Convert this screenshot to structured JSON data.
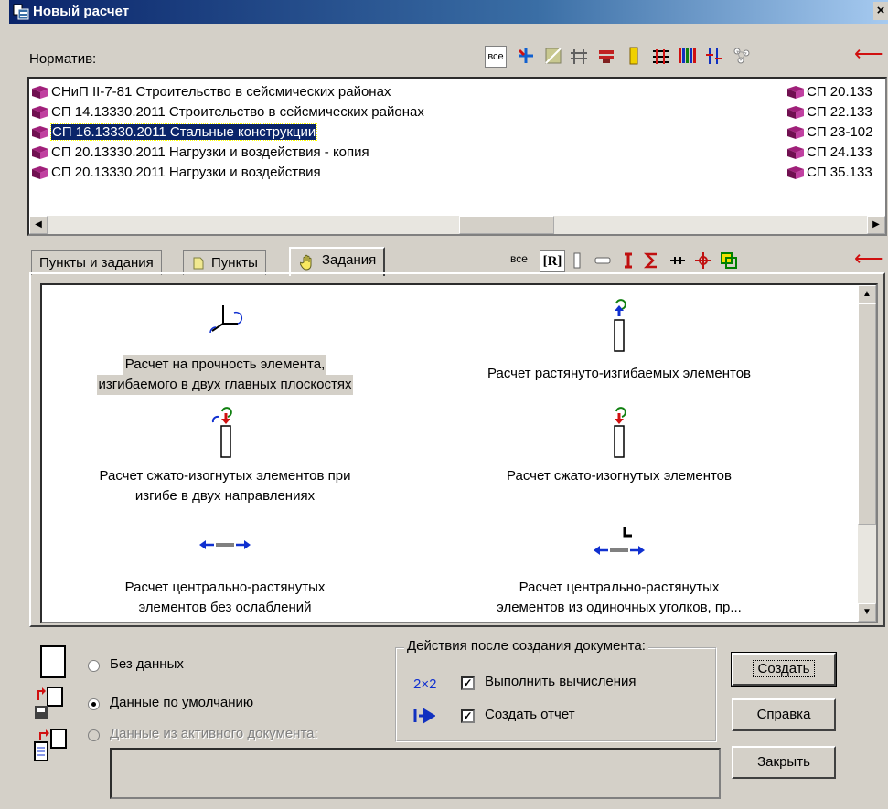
{
  "window": {
    "title": "Новый расчет",
    "close_glyph": "×"
  },
  "normative": {
    "label": "Норматив:",
    "filter_all": "все",
    "items": [
      {
        "label": "СНиП II-7-81 Строительство в сейсмических районах",
        "selected": false
      },
      {
        "label": "СП 14.13330.2011 Строительство в сейсмических районах",
        "selected": false
      },
      {
        "label": "СП 16.13330.2011 Стальные конструкции",
        "selected": true
      },
      {
        "label": "СП 20.13330.2011 Нагрузки и воздействия - копия",
        "selected": false
      },
      {
        "label": "СП 20.13330.2011 Нагрузки и воздействия",
        "selected": false
      }
    ],
    "items_col2": [
      "СП 20.133",
      "СП 22.133",
      "СП 23-102",
      "СП 24.133",
      "СП 35.133"
    ]
  },
  "tabs": [
    {
      "label": "Пункты и задания",
      "active": false
    },
    {
      "label": "Пункты",
      "active": false
    },
    {
      "label": "Задания",
      "active": true
    }
  ],
  "task_filter": {
    "all": "все",
    "r": "[R]"
  },
  "tasks": [
    {
      "line1": "Расчет на прочность элемента,",
      "line2": "изгибаемого в двух главных плоскостях",
      "selected": true
    },
    {
      "line1": "Расчет растянуто-изгибаемых элементов",
      "line2": "",
      "selected": false
    },
    {
      "line1": "Расчет сжато-изогнутых элементов при",
      "line2": "изгибе в двух направлениях",
      "selected": false
    },
    {
      "line1": "Расчет сжато-изогнутых элементов",
      "line2": "",
      "selected": false
    },
    {
      "line1": "Расчет центрально-растянутых",
      "line2": "элементов без ослаблений",
      "selected": false
    },
    {
      "line1": "Расчет центрально-растянутых",
      "line2": "элементов из одиночных уголков, пр...",
      "selected": false
    }
  ],
  "data_source": {
    "no_data": "Без данных",
    "default_data": "Данные по умолчанию",
    "active_doc": "Данные из активного документа:",
    "selected": "default_data"
  },
  "actions": {
    "group_label": "Действия после создания документа:",
    "compute_icon_text": "2×2",
    "compute": {
      "label": "Выполнить вычисления",
      "checked": true
    },
    "report": {
      "label": "Создать отчет",
      "checked": true
    },
    "check_glyph": "✓"
  },
  "buttons": {
    "create": "Создать",
    "help": "Справка",
    "close": "Закрыть"
  },
  "colors": {
    "title_bar": "#0a246a",
    "selection": "#0a246a",
    "arrow": "#d01010"
  }
}
